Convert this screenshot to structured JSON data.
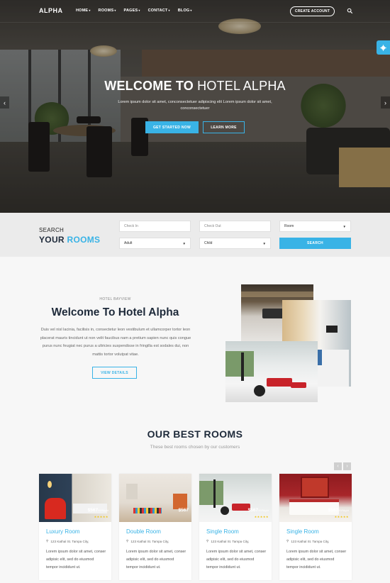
{
  "nav": {
    "logo": "ALPHA",
    "links": [
      "HOME",
      "ROOMS",
      "PAGES",
      "CONTACT",
      "BLOG"
    ],
    "create_account": "CREATE ACCOUNT"
  },
  "hero": {
    "title_bold": "WELCOME TO",
    "title_light": "HOTEL ALPHA",
    "subtitle": "Lorem ipsum dolor sit amet, conconsectetuer adipiscing elit Lorem ipsum dolor sit amet, conconsectetuer",
    "btn_start": "GET STARTED NOW",
    "btn_learn": "LEARN MORE"
  },
  "search": {
    "heading_line1": "SEARCH",
    "heading_line2_a": "YOUR",
    "heading_line2_b": "ROOMS",
    "checkin_placeholder": "Check In",
    "checkout_placeholder": "Check Out",
    "room_select": "Room",
    "adult_select": "Adult",
    "child_select": "Child",
    "button": "SEARCH"
  },
  "welcome": {
    "eyebrow": "HOTEL BAYVIEW",
    "title": "Welcome To Hotel Alpha",
    "text": "Duis vel nisl lacinia, facilisis in, consectetur leon vestibulum et ullamcorper tortor leon placerat mauris tincidunt ut non velit faucibus nam a pretium sapien nunc quis congue purus nunc feugiat nec purus a ultricies suspendisse in fringilla est sodales dui, non mattis tortor volutpat vitae.",
    "button": "VIEW DETAILS"
  },
  "rooms": {
    "title": "OUR BEST ROOMS",
    "subtitle": "These best rooms chosen by our customers",
    "cards": [
      {
        "name": "Luxury Room",
        "price": "$567",
        "per": "99/Night",
        "address": "123 Kathal St. Tampa City,",
        "desc": "Lorem ipsum dolor sit amet, conser adipisic elit, sed do eiusmod tempor incididunt ut."
      },
      {
        "name": "Double Room",
        "price": "$567",
        "per": "",
        "address": "123 Kathal St. Tampa City,",
        "desc": "Lorem ipsum dolor sit amet, conser adipisic elit, sed do eiusmod tempor incididunt ut."
      },
      {
        "name": "Single Room",
        "price": "$567",
        "per": "99/Night",
        "address": "123 Kathal St. Tampa City,",
        "desc": "Lorem ipsum dolor sit amet, conser adipisic elit, sed do eiusmod tempor incididunt ut."
      },
      {
        "name": "Single Room",
        "price": "$567",
        "per": "99/Night",
        "address": "123 Kathal St. Tampa City,",
        "desc": "Lorem ipsum dolor sit amet, conser adipisic elit, sed do eiusmod tempor incididunt ut."
      }
    ]
  },
  "colors": {
    "accent": "#39b3e6",
    "dark_heading": "#1e2a3a",
    "star": "#f1c40f"
  },
  "icons": {
    "nav_search": "search-icon",
    "settings": "gear-icon",
    "slider_prev": "chevron-left-icon",
    "slider_next": "chevron-right-icon",
    "address": "map-pin-icon",
    "rating": "star-icon"
  },
  "rating": {
    "stars_per_card": 5
  }
}
